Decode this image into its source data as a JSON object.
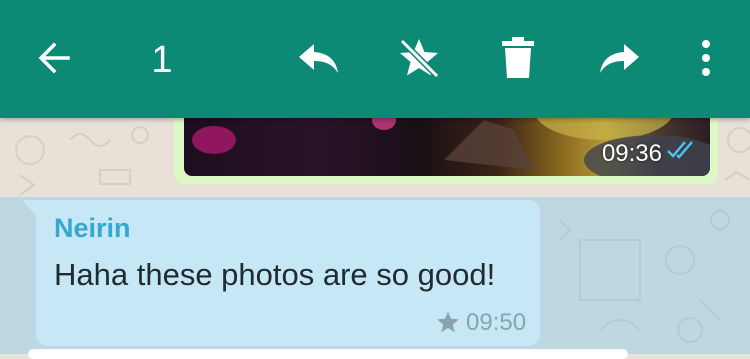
{
  "toolbar": {
    "selected_count": "1",
    "icons": [
      "back-arrow-icon",
      "reply-icon",
      "unstar-icon",
      "delete-icon",
      "forward-icon",
      "more-options-icon"
    ],
    "background": "#0c8a75"
  },
  "messages": [
    {
      "type": "image",
      "direction": "outgoing",
      "time": "09:36",
      "status": "read",
      "bubble_color": "#dcf8c6"
    },
    {
      "type": "text",
      "direction": "incoming",
      "sender": "Neirin",
      "text": "Haha these photos are so good!",
      "time": "09:50",
      "starred": true,
      "selected": true,
      "sender_color": "#34a8cf"
    }
  ]
}
